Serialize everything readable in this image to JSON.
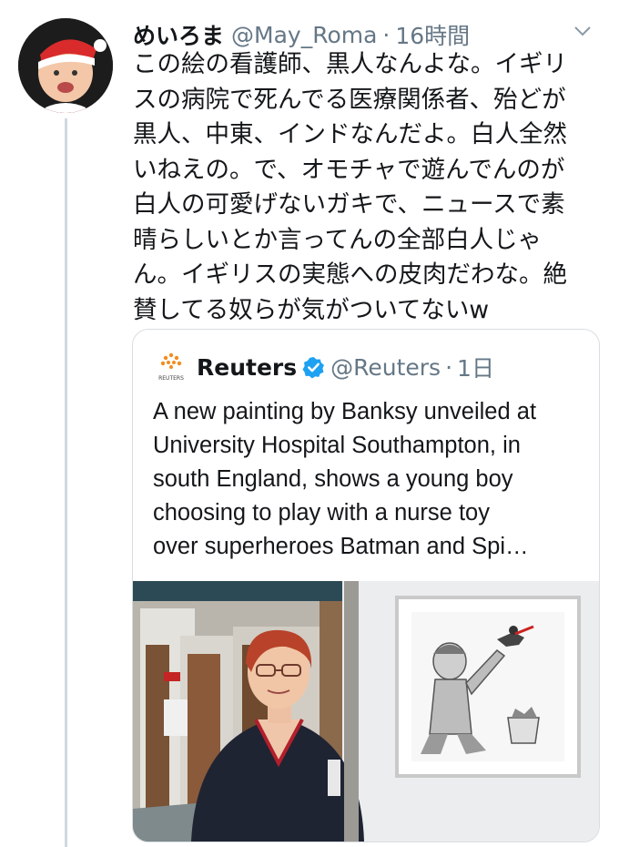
{
  "tweet": {
    "display_name": "めいろま",
    "handle": "@May_Roma",
    "dot": "·",
    "time": "16時間",
    "lines": [
      "この絵の看護師、黒人なんよな。イギリ",
      "スの病院で死んでる医療関係者、殆どが",
      "黒人、中東、インドなんだよ。白人全然",
      "いねえの。で、オモチャで遊んでんのが",
      "白人の可愛げないガキで、ニュースで素",
      "晴らしいとか言ってんの全部白人じゃ",
      "ん。イギリスの実態への皮肉だわな。絶",
      "賛してる奴らが気がついてないw"
    ]
  },
  "quote": {
    "logo_text": "REUTERS",
    "name": "Reuters",
    "handle": "@Reuters",
    "dot": "·",
    "time": "1日",
    "lines": [
      "A new painting by Banksy unveiled at",
      "University Hospital Southampton, in",
      "south England, shows a young boy",
      "choosing to play with a nurse toy",
      "over superheroes Batman and Spi…"
    ]
  },
  "colors": {
    "text": "#14171a",
    "secondary": "#657786",
    "verified": "#1da1f2",
    "border": "#d8dde1",
    "thread_line": "#cfd9de",
    "reuters_orange": "#f28c1e"
  },
  "icons": {
    "avatar": "baby-avatar",
    "menu": "chevron-down-icon",
    "verified": "verified-badge-icon",
    "logo": "reuters-logo"
  }
}
